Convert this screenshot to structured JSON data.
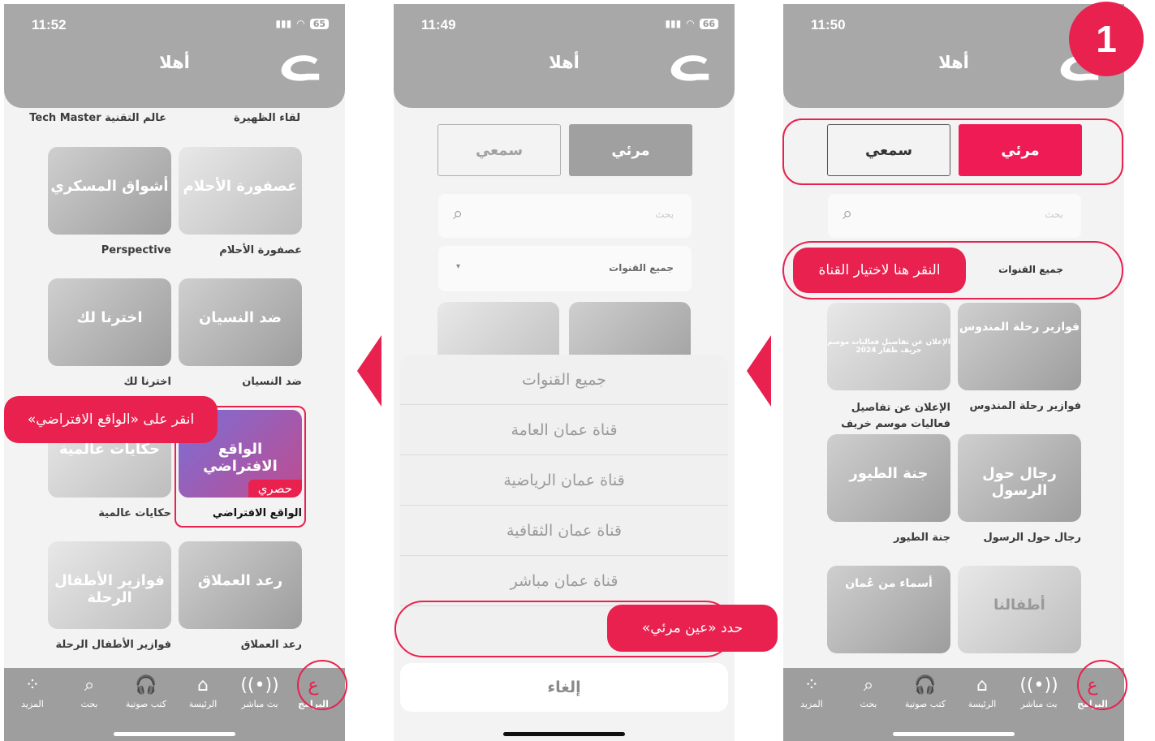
{
  "colors": {
    "accent": "#e8214f",
    "gray_header": "#a8a8a8",
    "tabbar": "#9e9e9e"
  },
  "step_number": "1",
  "tabs": [
    {
      "label": "البرامج",
      "icon": "brand-logo-icon"
    },
    {
      "label": "بث مباشر",
      "icon": "live-broadcast-icon"
    },
    {
      "label": "الرئيسة",
      "icon": "home-icon"
    },
    {
      "label": "كتب صوتية",
      "icon": "headphones-icon"
    },
    {
      "label": "بحث",
      "icon": "search-icon"
    },
    {
      "label": "المزيد",
      "icon": "more-grid-icon"
    }
  ],
  "screen_right": {
    "time": "11:50",
    "greeting": "أهلا",
    "segment_visual": "مرئي",
    "segment_audio": "سمعي",
    "search_placeholder": "بحث",
    "dropdown_value": "جميع القنوات",
    "callout": "النقر هنا لاختيار القناة",
    "cards": [
      {
        "thumb": "فوازير رحلة المندوس",
        "title": "فوازير رحلة المندوس"
      },
      {
        "thumb": "الإعلان عن تفاصيل فعاليات موسم خريف ظفار 2024",
        "title": "الإعلان عن تفاصيل فعاليات موسم خريف"
      },
      {
        "thumb": "رجال حول الرسول",
        "title": "رجال حول الرسول"
      },
      {
        "thumb": "جنة الطيور",
        "title": "جنة الطيور"
      },
      {
        "thumb": "أطفالنا",
        "title": ""
      },
      {
        "thumb": "أسماء من عُمان",
        "title": ""
      }
    ]
  },
  "screen_middle": {
    "time": "11:49",
    "battery": "66",
    "greeting": "أهلا",
    "segment_visual": "مرئي",
    "segment_audio": "سمعي",
    "search_placeholder": "بحث",
    "dropdown_value": "جميع القنوات",
    "options": [
      "جميع القنوات",
      "قناة عمان العامة",
      "قناة عمان الرياضية",
      "قناة عمان الثقافية",
      "قناة عمان مباشر"
    ],
    "selected_option": "عين مرئي",
    "cancel": "إلغاء",
    "callout": "حدد «عين مرئي»"
  },
  "screen_left": {
    "time": "11:52",
    "battery": "65",
    "greeting": "أهلا",
    "row_headers": [
      "لقاء الظهيرة",
      "عالم التقنية Tech Master"
    ],
    "cards": [
      {
        "thumb": "عصفورة الأحلام",
        "title": "عصفورة الأحلام"
      },
      {
        "thumb": "أشواق المسكري",
        "title": "Perspective"
      },
      {
        "thumb": "ضد النسيان",
        "title": "ضد النسيان"
      },
      {
        "thumb": "اخترنا لك",
        "title": "اخترنا لك"
      },
      {
        "thumb": "الواقع الافتراضي",
        "title": "الواقع الافتراضي",
        "badge": "حصري"
      },
      {
        "thumb": "حكايات عالمية",
        "title": "حكايات عالمية"
      },
      {
        "thumb": "رعد العملاق",
        "title": "رعد العملاق"
      },
      {
        "thumb": "فوازير الأطفال الرحلة",
        "title": "فوازير الأطفال الرحلة"
      }
    ],
    "callout": "انقر على «الواقع الافتراضي»"
  }
}
